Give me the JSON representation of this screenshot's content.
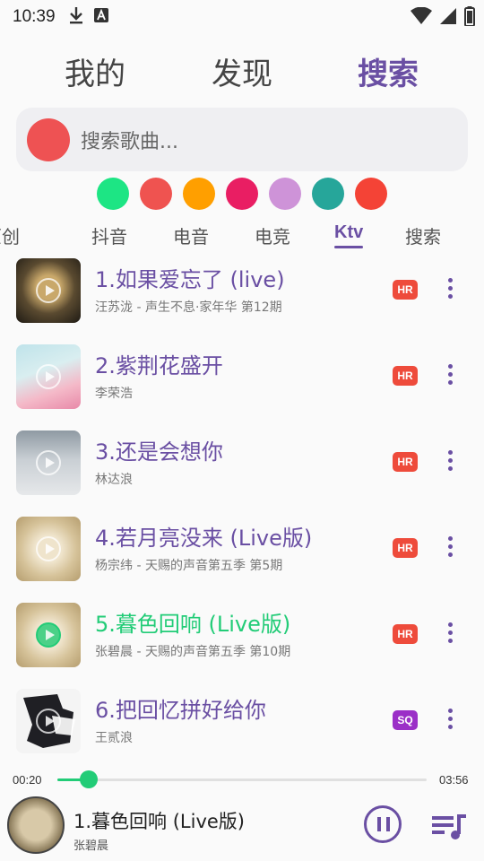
{
  "status": {
    "time": "10:39"
  },
  "tabs": [
    "我的",
    "发现",
    "搜索"
  ],
  "search": {
    "placeholder": "搜索歌曲..."
  },
  "colors": [
    "#1de584",
    "#ef5350",
    "#ff9f00",
    "#e91e63",
    "#ce93d8",
    "#26a69a",
    "#f44336"
  ],
  "categories": [
    "原创",
    "抖音",
    "电音",
    "电竞",
    "Ktv",
    "搜索"
  ],
  "songs": [
    {
      "title": "1.如果爱忘了 (live)",
      "subtitle": "汪苏泷 - 声生不息·家年华 第12期",
      "badge": "HR"
    },
    {
      "title": "2.紫荆花盛开",
      "subtitle": "李荣浩",
      "badge": "HR"
    },
    {
      "title": "3.还是会想你",
      "subtitle": "林达浪",
      "badge": "HR"
    },
    {
      "title": "4.若月亮没来 (Live版)",
      "subtitle": "杨宗纬 - 天赐的声音第五季 第5期",
      "badge": "HR"
    },
    {
      "title": "5.暮色回响 (Live版)",
      "subtitle": "张碧晨 - 天赐的声音第五季 第10期",
      "badge": "HR"
    },
    {
      "title": "6.把回忆拼好给你",
      "subtitle": "王贰浪",
      "badge": "SQ"
    }
  ],
  "progress": {
    "current": "00:20",
    "total": "03:56",
    "fraction": 0.085
  },
  "player": {
    "title": "1.暮色回响 (Live版)",
    "artist": "张碧晨"
  },
  "accent": "#6a4fa3",
  "playing_color": "#22cc77"
}
